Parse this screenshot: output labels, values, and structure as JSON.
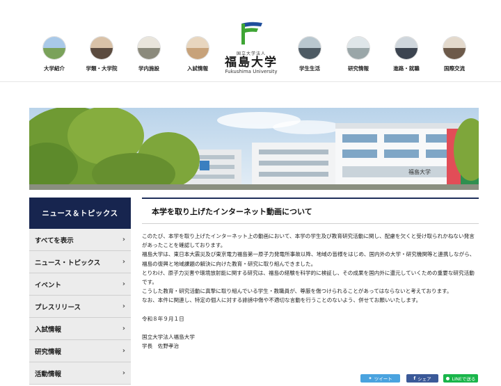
{
  "header": {
    "nav_left": [
      {
        "label": "大学紹介",
        "icon": "campus-photo-icon"
      },
      {
        "label": "学類・大学院",
        "icon": "students-photo-icon"
      },
      {
        "label": "学内施設",
        "icon": "facility-photo-icon"
      },
      {
        "label": "入試情報",
        "icon": "exam-photo-icon"
      }
    ],
    "nav_right": [
      {
        "label": "学生生活",
        "icon": "student-life-photo-icon"
      },
      {
        "label": "研究情報",
        "icon": "research-photo-icon"
      },
      {
        "label": "進路・就職",
        "icon": "career-photo-icon"
      },
      {
        "label": "国際交流",
        "icon": "international-photo-icon"
      }
    ],
    "logo": {
      "sub": "国立大学法人",
      "main": "福島大学",
      "en": "Fukushima University"
    }
  },
  "sidebar": {
    "title": "ニュース＆トピックス",
    "items": [
      {
        "label": "すべてを表示"
      },
      {
        "label": "ニュース・トピックス"
      },
      {
        "label": "イベント"
      },
      {
        "label": "プレスリリース"
      },
      {
        "label": "入試情報"
      },
      {
        "label": "研究情報"
      },
      {
        "label": "活動情報"
      }
    ],
    "chevron": "›"
  },
  "article": {
    "title": "本学を取り上げたインターネット動画について",
    "paragraphs": [
      "このたび、本学を取り上げたインターネット上の動画において、本学の学生及び教育研究活動に関し、配慮を欠くと受け取られかねない発言があったことを確認しております。",
      "福島大学は、東日本大震災及び東京電力福島第一原子力発電所事故以降、地域の皆様をはじめ、国内外の大学・研究機関等と連携しながら、福島の復興と地域課題の解決に向けた教育・研究に取り組んできました。",
      "とりわけ、原子力災害や環境放射能に関する研究は、福島の経験を科学的に検証し、その成果を国内外に還元していくための重要な研究活動です。",
      "こうした教育・研究活動に真摯に取り組んでいる学生・教職員が、尊厳を傷つけられることがあってはならないと考えております。",
      "なお、本件に関連し、特定の個人に対する誹謗中傷や不適切な言動を行うことのないよう、併せてお願いいたします。"
    ],
    "date": "令和８年９月１日",
    "signature_org": "国立大学法人福島大学",
    "signature_name": "学長　佐野孝治"
  },
  "share": {
    "tweet": "ツイート",
    "facebook": "シェア",
    "line": "LINEで送る"
  },
  "colors": {
    "navy": "#17254f",
    "logo_green": "#3fa535",
    "logo_blue": "#1f4e9c",
    "twitter": "#4aa3df",
    "facebook": "#3b5998",
    "line": "#19b54a"
  },
  "hero": {
    "signage": "福島大学"
  }
}
